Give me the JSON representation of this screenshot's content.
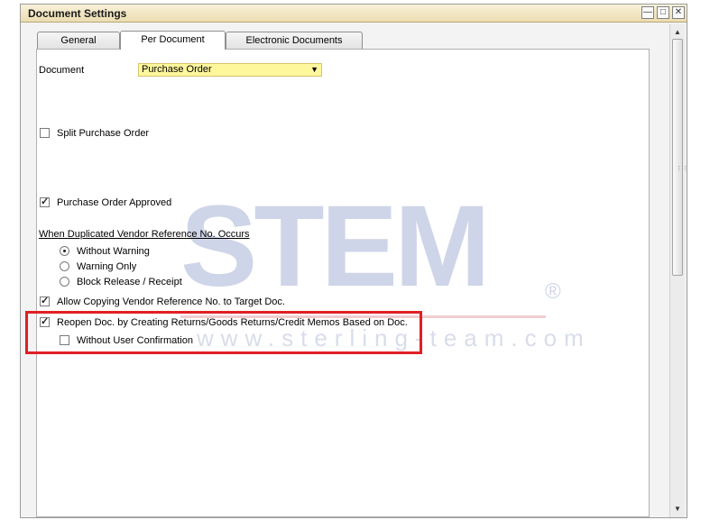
{
  "window": {
    "title": "Document Settings",
    "controls": [
      "minimize",
      "maximize",
      "close"
    ]
  },
  "tabs": [
    {
      "label": "General",
      "active": false
    },
    {
      "label": "Per Document",
      "active": true
    },
    {
      "label": "Electronic Documents",
      "active": false
    }
  ],
  "document": {
    "label": "Document",
    "selected": "Purchase Order"
  },
  "options": {
    "split_po": {
      "label": "Split Purchase Order",
      "checked": false
    },
    "po_approved": {
      "label": "Purchase Order Approved",
      "checked": true
    },
    "duplicate_heading": "When Duplicated Vendor Reference No. Occurs",
    "radios": [
      {
        "label": "Without Warning",
        "selected": true
      },
      {
        "label": "Warning Only",
        "selected": false
      },
      {
        "label": "Block Release / Receipt",
        "selected": false
      }
    ],
    "allow_copying": {
      "label": "Allow Copying Vendor Reference No. to Target Doc.",
      "checked": true
    },
    "reopen_doc": {
      "label": "Reopen Doc. by Creating Returns/Goods Returns/Credit Memos Based on Doc.",
      "checked": true
    },
    "without_confirmation": {
      "label": "Without User Confirmation",
      "checked": false
    }
  },
  "watermark": {
    "brand": "STEM",
    "registered": "®",
    "url": "www.sterling-team.com"
  },
  "colors": {
    "title_bar": "#ecdcb0",
    "select_bg": "#fff79c",
    "highlight": "#e01f26",
    "watermark": "#cfd5e8"
  }
}
